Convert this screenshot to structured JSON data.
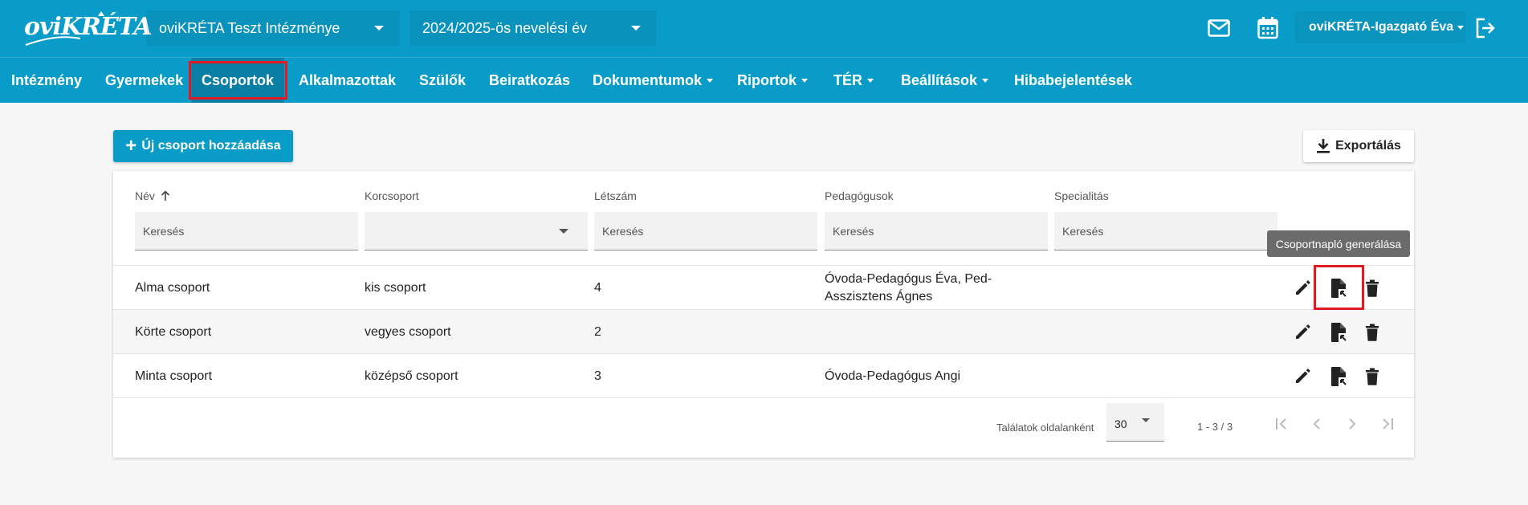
{
  "header": {
    "logo_text": "oviKRÉTA",
    "institution": "oviKRÉTA Teszt Intézménye",
    "school_year": "2024/2025-ös nevelési év",
    "user": "oviKRÉTA-Igazgató Éva",
    "icons": [
      "mail-icon",
      "calendar-icon",
      "logout-icon"
    ]
  },
  "nav": {
    "items": [
      {
        "label": "Intézmény"
      },
      {
        "label": "Gyermekek"
      },
      {
        "label": "Csoportok"
      },
      {
        "label": "Alkalmazottak"
      },
      {
        "label": "Szülők"
      },
      {
        "label": "Beiratkozás"
      },
      {
        "label": "Dokumentumok"
      },
      {
        "label": "Riportok"
      },
      {
        "label": "TÉR"
      },
      {
        "label": "Beállítások"
      },
      {
        "label": "Hibabejelentések"
      }
    ],
    "active": "Csoportok"
  },
  "toolbar": {
    "add_label": "Új csoport hozzáadása",
    "export_label": "Exportálás"
  },
  "table": {
    "columns": [
      "Név",
      "Korcsoport",
      "Létszám",
      "Pedagógusok",
      "Specialitás"
    ],
    "filter_placeholder": "Keresés",
    "rows": [
      {
        "name": "Alma csoport",
        "group": "kis csoport",
        "count": "4",
        "teachers": "Óvoda-Pedagógus Éva, Ped-Asszisztens Ágnes",
        "specialty": ""
      },
      {
        "name": "Körte csoport",
        "group": "vegyes csoport",
        "count": "2",
        "teachers": "",
        "specialty": ""
      },
      {
        "name": "Minta csoport",
        "group": "középső csoport",
        "count": "3",
        "teachers": "Óvoda-Pedagógus Angi",
        "specialty": ""
      }
    ],
    "tooltip": "Csoportnapló generálása"
  },
  "pagination": {
    "per_page_label": "Találatok oldalanként",
    "per_page": "30",
    "range": "1 - 3 / 3"
  },
  "colors": {
    "brand": "#0a9cc8",
    "nav_active": "#0a7fa6",
    "highlight": "#e01b24"
  }
}
